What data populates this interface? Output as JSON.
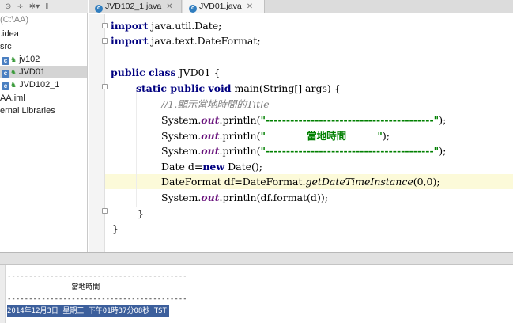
{
  "project": {
    "toolbar_icons": [
      "target-icon",
      "split-icon",
      "gear-icon",
      "collapse-icon"
    ],
    "tree": [
      {
        "label": "(C:\\AA)",
        "muted": true
      },
      {
        "label": ".idea"
      },
      {
        "label": "src"
      },
      {
        "label": "jv102",
        "module": true
      },
      {
        "label": "JVD01",
        "module": true,
        "selected": true
      },
      {
        "label": "JVD102_1",
        "module": true
      },
      {
        "label": "AA.iml"
      },
      {
        "label": "ernal Libraries"
      }
    ]
  },
  "tabs": [
    {
      "label": "JVD102_1.java",
      "active": false
    },
    {
      "label": "JVD01.java",
      "active": true
    }
  ],
  "code": {
    "imports": [
      {
        "kw": "import",
        "rest": " java.util.Date;"
      },
      {
        "kw": "import",
        "rest": " java.text.DateFormat;"
      }
    ],
    "class_kw": "public class",
    "class_name": " JVD01 {",
    "method_kw": "static public void",
    "method_rest": " main(String[] args) {",
    "comment": "//1.顯示當地時間的Title",
    "print_prefix": "System.",
    "print_field": "out",
    "print_method": ".println(",
    "dash_string": "\"-----------------------------------------\"",
    "title_string": "\"            當地時間         \"",
    "print_end": ");",
    "date_decl_a": "Date d=",
    "date_decl_new": "new",
    "date_decl_b": " Date();",
    "df_decl_a": "DateFormat df=DateFormat.",
    "df_decl_method": "getDateTimeInstance",
    "df_decl_b": "(0,0);",
    "format_call": ".println(df.format(d));",
    "close_method": "}",
    "close_class": "}"
  },
  "run": {
    "header_label": "",
    "output": [
      "------------------------------------------",
      "               當地時間",
      "------------------------------------------",
      "2014年12月3日 星期三 下午01時37分08秒 TST"
    ]
  },
  "colors": {
    "keyword": "#000080",
    "field": "#660e7a",
    "string": "#008000",
    "comment": "#808080",
    "caret_row": "#fcfad9",
    "selection": "#3c5f9c"
  }
}
